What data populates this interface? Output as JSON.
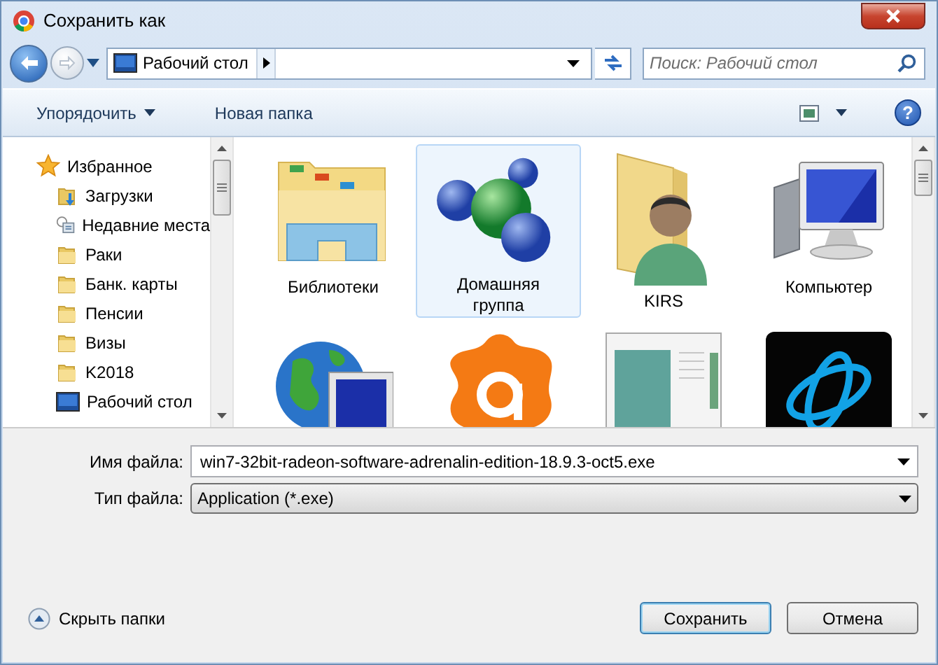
{
  "window": {
    "title": "Сохранить как"
  },
  "address_bar": {
    "location": "Рабочий стол"
  },
  "search": {
    "placeholder": "Поиск: Рабочий стол"
  },
  "toolbar": {
    "organize": "Упорядочить",
    "new_folder": "Новая папка"
  },
  "sidebar": {
    "items": [
      {
        "kind": "favorites",
        "label": "Избранное"
      },
      {
        "kind": "downloads",
        "label": "Загрузки"
      },
      {
        "kind": "recent",
        "label": "Недавние места"
      },
      {
        "kind": "folder",
        "label": "Раки"
      },
      {
        "kind": "folder",
        "label": "Банк. карты"
      },
      {
        "kind": "folder",
        "label": "Пенсии"
      },
      {
        "kind": "folder",
        "label": "Визы"
      },
      {
        "kind": "folder",
        "label": "K2018"
      },
      {
        "kind": "desktop",
        "label": "Рабочий стол"
      }
    ]
  },
  "items": [
    {
      "kind": "libraries",
      "label": "Библиотеки",
      "selected": false
    },
    {
      "kind": "homegroup",
      "label": "Домашняя группа",
      "selected": true
    },
    {
      "kind": "user-folder",
      "label": "KIRS",
      "selected": false
    },
    {
      "kind": "computer",
      "label": "Компьютер",
      "selected": false
    },
    {
      "kind": "network",
      "selected": false
    },
    {
      "kind": "antivirus",
      "selected": false
    },
    {
      "kind": "window",
      "selected": false
    },
    {
      "kind": "game-launcher",
      "selected": false
    }
  ],
  "file_name": {
    "label": "Имя файла:",
    "value": "win7-32bit-radeon-software-adrenalin-edition-18.9.3-oct5.exe"
  },
  "file_type": {
    "label": "Тип файла:",
    "value": "Application (*.exe)"
  },
  "help": {
    "glyph": "?"
  },
  "hide_folders": "Скрыть папки",
  "buttons": {
    "save": "Сохранить",
    "cancel": "Отмена"
  }
}
